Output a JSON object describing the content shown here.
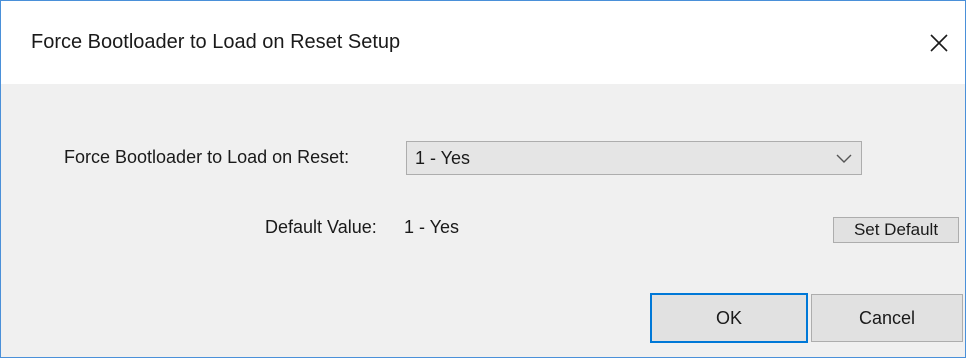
{
  "window": {
    "title": "Force Bootloader to Load on Reset Setup",
    "close_icon": "close-icon"
  },
  "form": {
    "field_label": "Force Bootloader to Load on Reset:",
    "selected_value": "1 - Yes",
    "dropdown_icon": "chevron-down-icon",
    "default_label": "Default Value:",
    "default_value": "1 - Yes",
    "set_default_label": "Set Default"
  },
  "buttons": {
    "ok_label": "OK",
    "cancel_label": "Cancel"
  },
  "colors": {
    "client_background": "#f0f0f0",
    "titlebar_background": "#ffffff",
    "window_border": "#4a90d9",
    "focus_border": "#0078d7",
    "button_face": "#e1e1e1",
    "combo_face": "#e5e5e5"
  }
}
